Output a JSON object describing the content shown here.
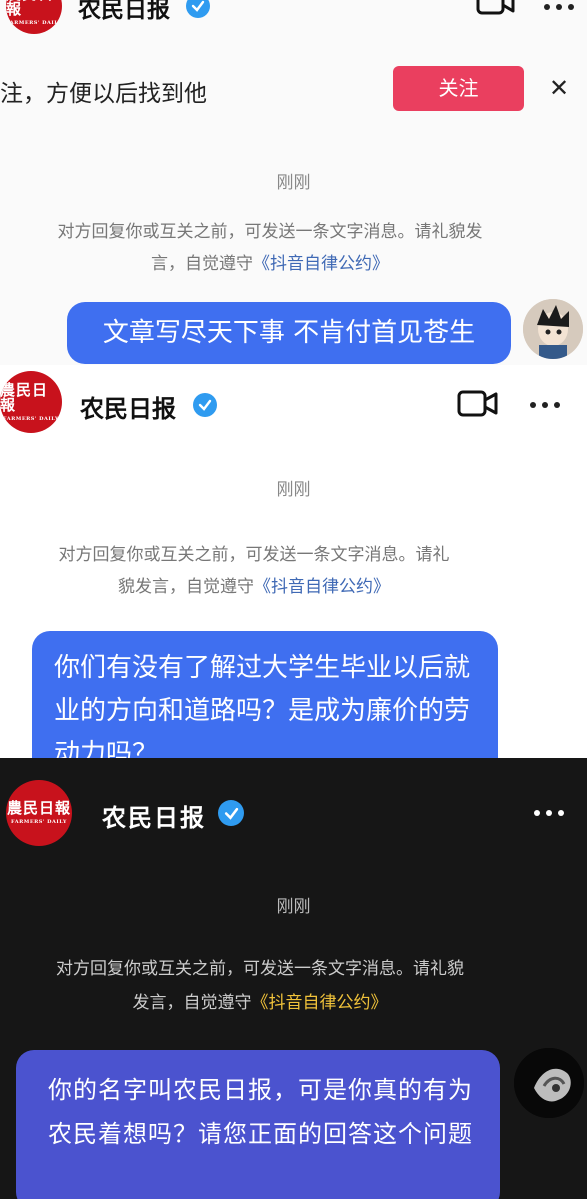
{
  "top": {
    "channel_name": "农民日报",
    "logo_text": "農民日報",
    "logo_subtext": "FARMERS' DAILY",
    "follow_prompt": "注，方便以后找到他",
    "follow_button": "关注",
    "close_symbol": "✕",
    "timestamp": "刚刚",
    "notice_line1": "对方回复你或互关之前，可发送一条文字消息。请礼貌发",
    "notice_line2_prefix": "言，自觉遵守",
    "notice_link": "《抖音自律公约》",
    "message": "文章写尽天下事 不肯付首见苍生"
  },
  "middle": {
    "channel_name": "农民日报",
    "logo_text": "農民日報",
    "logo_subtext": "FARMERS' DAILY",
    "timestamp": "刚刚",
    "notice_line1": "对方回复你或互关之前，可发送一条文字消息。请礼",
    "notice_line2_prefix": "貌发言，自觉遵守",
    "notice_link": "《抖音自律公约》",
    "message": "你们有没有了解过大学生毕业以后就业的方向和道路吗？是成为廉价的劳动力吗？"
  },
  "bottom": {
    "channel_name": "农民日报",
    "logo_text": "農民日報",
    "logo_subtext": "FARMERS' DAILY",
    "timestamp": "刚刚",
    "notice_line1": "对方回复你或互关之前，可发送一条文字消息。请礼貌",
    "notice_line2_prefix": "发言，自觉遵守",
    "notice_link": "《抖音自律公约》",
    "message": "你的名字叫农民日报，可是你真的有为农民着想吗？请您正面的回答这个问题"
  },
  "colors": {
    "follow_button": "#ea3f5f",
    "bubble_blue": "#3f6ff0",
    "bubble_dark": "#4b53cf",
    "logo_red": "#c8121c",
    "link_blue": "#3f69b5",
    "link_gold": "#f0c23a",
    "verified": "#2f9bf0"
  },
  "icons": [
    "verified-icon",
    "video-call-icon",
    "more-icon",
    "close-icon"
  ]
}
